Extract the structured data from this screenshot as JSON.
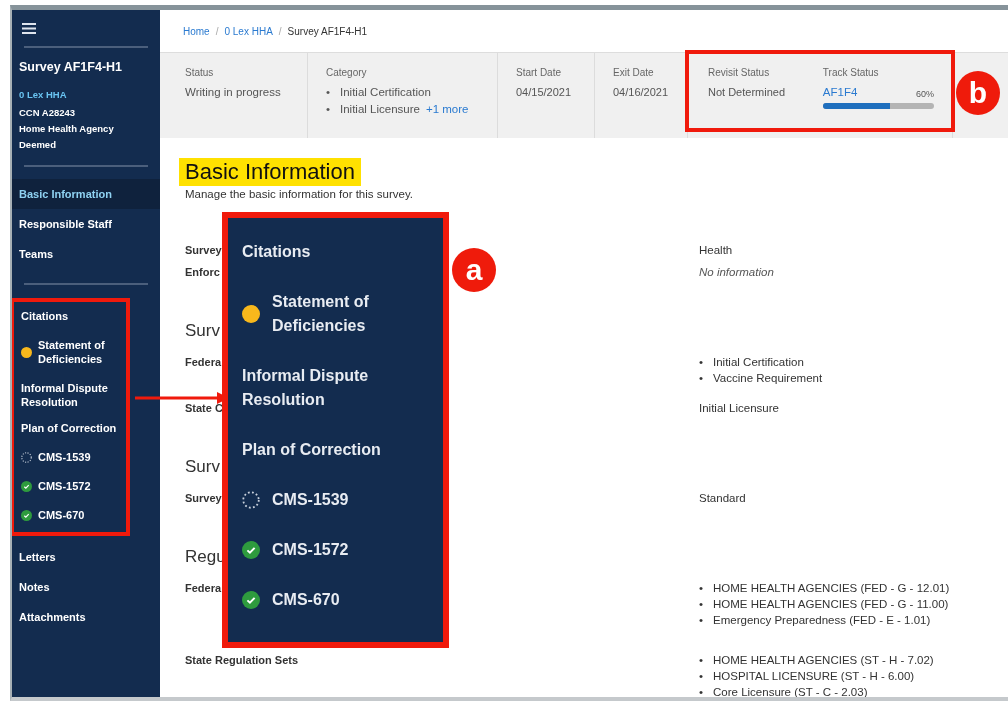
{
  "sidebar": {
    "title": "Survey AF1F4-H1",
    "provider_link": "0 Lex HHA",
    "details": [
      "CCN A28243",
      "Home Health Agency",
      "Deemed"
    ],
    "sections": [
      {
        "items": [
          {
            "label": "Basic Information",
            "selected": true
          },
          {
            "label": "Responsible Staff",
            "selected": false
          },
          {
            "label": "Teams",
            "selected": false
          }
        ]
      },
      {
        "highlighted_items": [
          {
            "label": "Citations",
            "selected": false
          },
          {
            "label": "Statement of Deficiencies",
            "selected": false,
            "kind": "pending"
          },
          {
            "label": "Informal Dispute Resolution",
            "selected": false
          },
          {
            "label": "Plan of Correction",
            "selected": false
          },
          {
            "label": "CMS-1539",
            "selected": false,
            "kind": "unstarted"
          },
          {
            "label": "CMS-1572",
            "selected": false,
            "kind": "done"
          },
          {
            "label": "CMS-670",
            "selected": false,
            "kind": "done"
          }
        ],
        "items": [
          {
            "label": "Letters",
            "selected": false
          },
          {
            "label": "Notes",
            "selected": false
          },
          {
            "label": "Attachments",
            "selected": false
          }
        ]
      }
    ]
  },
  "breadcrumb": {
    "links": [
      "Home",
      "0 Lex HHA"
    ],
    "separator": "/",
    "current": "Survey AF1F4-H1"
  },
  "header": {
    "status": {
      "label": "Status",
      "value": "Writing in progress"
    },
    "category": {
      "label": "Category",
      "bullet": "•",
      "items": [
        "Initial Certification",
        "Initial Licensure"
      ],
      "more": "+1 more"
    },
    "start_date": {
      "label": "Start Date",
      "value": "04/15/2021"
    },
    "exit_date": {
      "label": "Exit Date",
      "value": "04/16/2021"
    },
    "revisit_status": {
      "label": "Revisit Status",
      "value": "Not Determined"
    },
    "track_status": {
      "label": "Track Status",
      "link": "AF1F4",
      "percent": "60%",
      "level": 0.6
    }
  },
  "content": {
    "heading": "Basic Information",
    "description": "Manage the basic information for this survey.",
    "bullet": "•",
    "rows": [
      {
        "kind": "field",
        "label": "Survey",
        "value": "Health"
      },
      {
        "kind": "empty",
        "label": "Enforc",
        "value": "No information"
      },
      {
        "kind": "section",
        "label": "Surv"
      },
      {
        "kind": "list",
        "label": "Federa",
        "values": [
          "Initial Certification",
          "Vaccine Requirement"
        ]
      },
      {
        "kind": "field",
        "label": "State C",
        "value": "Initial Licensure"
      },
      {
        "kind": "section",
        "label": "Surv"
      },
      {
        "kind": "field",
        "label": "Survey",
        "value": "Standard"
      },
      {
        "kind": "section",
        "label": "Regu"
      },
      {
        "kind": "list",
        "label": "Federa",
        "values": [
          "HOME HEALTH AGENCIES (FED - G - 12.01)",
          "HOME HEALTH AGENCIES (FED - G - 11.00)",
          "Emergency Preparedness (FED - E - 1.01)"
        ]
      },
      {
        "kind": "list",
        "label": "State Regulation Sets",
        "values": [
          "HOME HEALTH AGENCIES (ST - H - 7.02)",
          "HOSPITAL LICENSURE (ST - H - 6.00)",
          "Core Licensure (ST - C - 2.03)"
        ]
      }
    ]
  },
  "annotations": {
    "heading_highlight": true,
    "zoom_callout": {
      "badge": "a",
      "items": [
        {
          "label": "Citations"
        },
        {
          "label": "Statement of Deficiencies",
          "kind": "pending"
        },
        {
          "label": "Informal Dispute Resolution"
        },
        {
          "label": "Plan of Correction"
        },
        {
          "label": "CMS-1539",
          "kind": "unstarted"
        },
        {
          "label": "CMS-1572",
          "kind": "done"
        },
        {
          "label": "CMS-670",
          "kind": "done"
        }
      ]
    },
    "header_callout": {
      "badge": "b"
    }
  }
}
